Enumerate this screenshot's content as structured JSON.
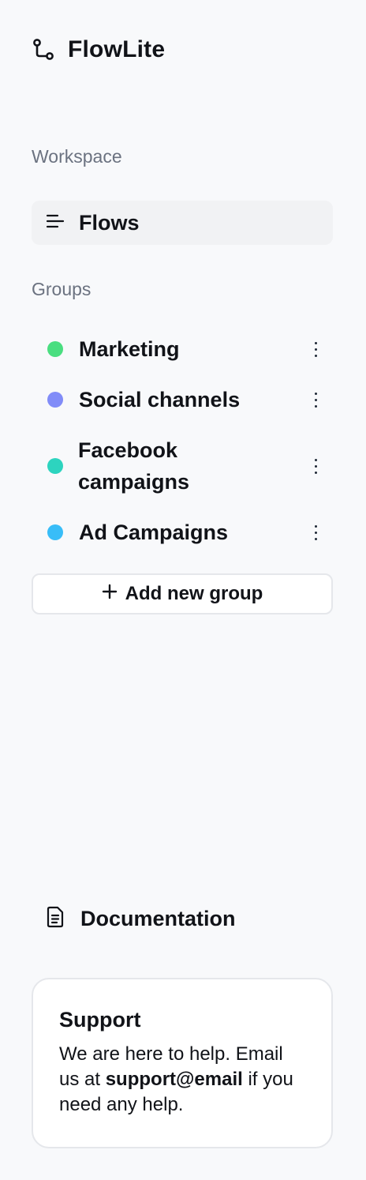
{
  "app": {
    "name": "FlowLite"
  },
  "workspace": {
    "label": "Workspace",
    "items": [
      {
        "label": "Flows",
        "icon": "menu-lines-icon",
        "active": true
      }
    ]
  },
  "groups": {
    "label": "Groups",
    "items": [
      {
        "label": "Marketing",
        "color": "#4ade80"
      },
      {
        "label": "Social channels",
        "color": "#818cf8"
      },
      {
        "label": "Facebook campaigns",
        "color": "#2dd4bf"
      },
      {
        "label": "Ad Campaigns",
        "color": "#38bdf8"
      }
    ],
    "add_label": "Add new group"
  },
  "documentation": {
    "label": "Documentation",
    "icon": "document-icon"
  },
  "support": {
    "title": "Support",
    "text_before": "We are here to help. Email us at ",
    "email": "support@email",
    "text_after": " if you need any help."
  }
}
